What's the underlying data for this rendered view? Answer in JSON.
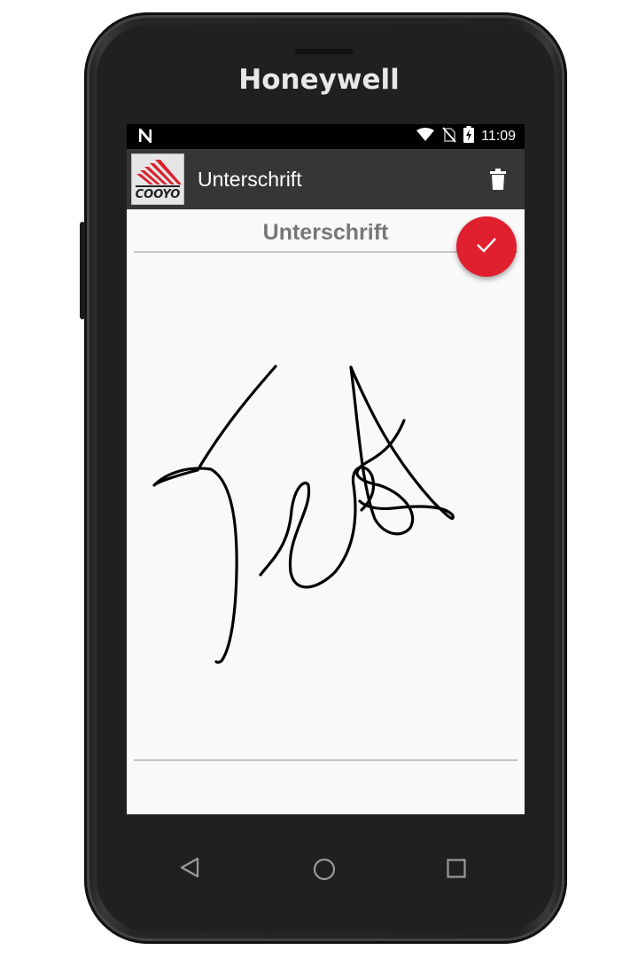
{
  "device": {
    "brand": "Honeywell"
  },
  "statusbar": {
    "notification_icon": "n-icon",
    "time": "11:09",
    "icons": [
      "wifi-icon",
      "no-sim-icon",
      "battery-charging-icon"
    ]
  },
  "appbar": {
    "logo": "coo-logo",
    "title": "Unterschrift",
    "action_icon": "trash-icon"
  },
  "content": {
    "title": "Unterschrift",
    "confirm_icon": "check-icon",
    "confirm_color": "#e0202f"
  },
  "navbar": {
    "buttons": [
      "back-icon",
      "home-icon",
      "recents-icon"
    ]
  }
}
